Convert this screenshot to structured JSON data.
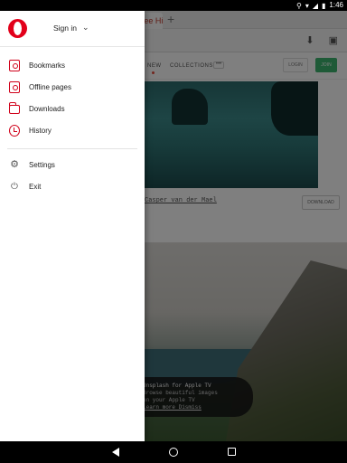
{
  "status_bar": {
    "time": "1:46",
    "icons": [
      "location-icon",
      "wifi-icon",
      "signal-icon",
      "battery-icon"
    ]
  },
  "background_page": {
    "tab_title": "Unsplash | Free Hi-Res Photos",
    "site_nav": {
      "new": "NEW",
      "collections": "COLLECTIONS",
      "more": "•••",
      "login": "LOGIN",
      "join": "JOIN"
    },
    "photo_credit": "Casper van der Mael",
    "download_label": "DOWNLOAD",
    "toast": {
      "line1": "Unsplash for Apple TV",
      "line2": "Browse beautiful images",
      "line3": "on your Apple TV",
      "line4": "Learn more  Dismiss"
    },
    "accent_colors": {
      "join": "#3cb46e",
      "brand": "#e2001a"
    }
  },
  "drawer": {
    "header": {
      "sign_in_label": "Sign in"
    },
    "items": [
      {
        "label": "Bookmarks",
        "icon": "bookmarks-icon"
      },
      {
        "label": "Offline pages",
        "icon": "offline-pages-icon"
      },
      {
        "label": "Downloads",
        "icon": "downloads-icon"
      },
      {
        "label": "History",
        "icon": "history-icon"
      }
    ],
    "secondary_items": [
      {
        "label": "Settings",
        "icon": "gear-icon"
      },
      {
        "label": "Exit",
        "icon": "power-icon"
      }
    ]
  },
  "nav_bar": {
    "buttons": [
      "back-icon",
      "home-icon",
      "recents-icon"
    ]
  }
}
